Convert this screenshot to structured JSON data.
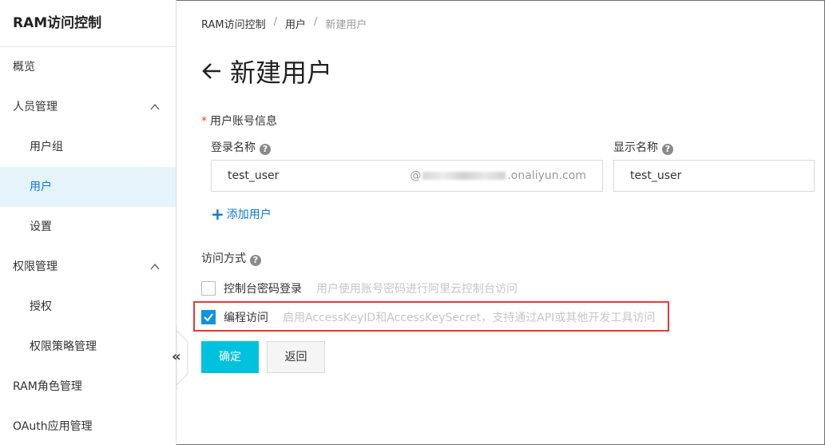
{
  "sidebar": {
    "title": "RAM访问控制",
    "items": [
      {
        "label": "概览"
      },
      {
        "label": "人员管理"
      },
      {
        "label": "用户组"
      },
      {
        "label": "用户"
      },
      {
        "label": "设置"
      },
      {
        "label": "权限管理"
      },
      {
        "label": "授权"
      },
      {
        "label": "权限策略管理"
      },
      {
        "label": "RAM角色管理"
      },
      {
        "label": "OAuth应用管理"
      }
    ],
    "collapse_glyph": "«"
  },
  "breadcrumb": {
    "root": "RAM访问控制",
    "sep1": "/",
    "mid": "用户",
    "sep2": "/",
    "current": "新建用户"
  },
  "page": {
    "title": "新建用户"
  },
  "form": {
    "account_section": "用户账号信息",
    "required_mark": "*",
    "login_name_label": "登录名称",
    "display_name_label": "显示名称",
    "help_glyph": "?",
    "login_name_value": "test_user",
    "domain_prefix": "@",
    "domain_suffix": ".onaliyun.com",
    "display_name_value": "test_user",
    "add_user_label": "添加用户",
    "add_user_glyph": "+",
    "access_section": "访问方式",
    "console_label": "控制台密码登录",
    "console_hint": "用户使用账号密码进行阿里云控制台访问",
    "console_checked": false,
    "api_label": "编程访问",
    "api_hint": "启用AccessKeyID和AccessKeySecret，支持通过API或其他开发工具访问",
    "api_checked": true
  },
  "buttons": {
    "confirm": "确定",
    "back": "返回"
  },
  "colors": {
    "primary": "#00c1de",
    "link": "#0b79d0",
    "active_bg": "#e4f4fa",
    "checkbox": "#1094de",
    "highlight": "#e33a34"
  }
}
